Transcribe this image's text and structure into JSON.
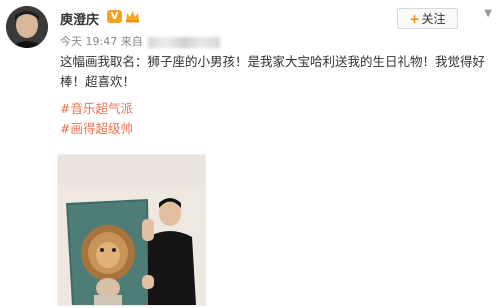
{
  "post": {
    "author_name": "庾澄庆",
    "verified_badge": "V",
    "follow_label": "关注",
    "time": "今天 19:47 来自",
    "content": "这幅画我取名：狮子座的小男孩！是我家大宝哈利送我的生日礼物！我觉得好棒！超喜欢！",
    "tags": [
      "#音乐超气派",
      "#画得超级帅"
    ]
  },
  "colors": {
    "accent": "#eb7350",
    "follow_plus": "#ff8200",
    "badge": "#f7a21b"
  },
  "icons": {
    "menu": "chevron-down-icon"
  }
}
